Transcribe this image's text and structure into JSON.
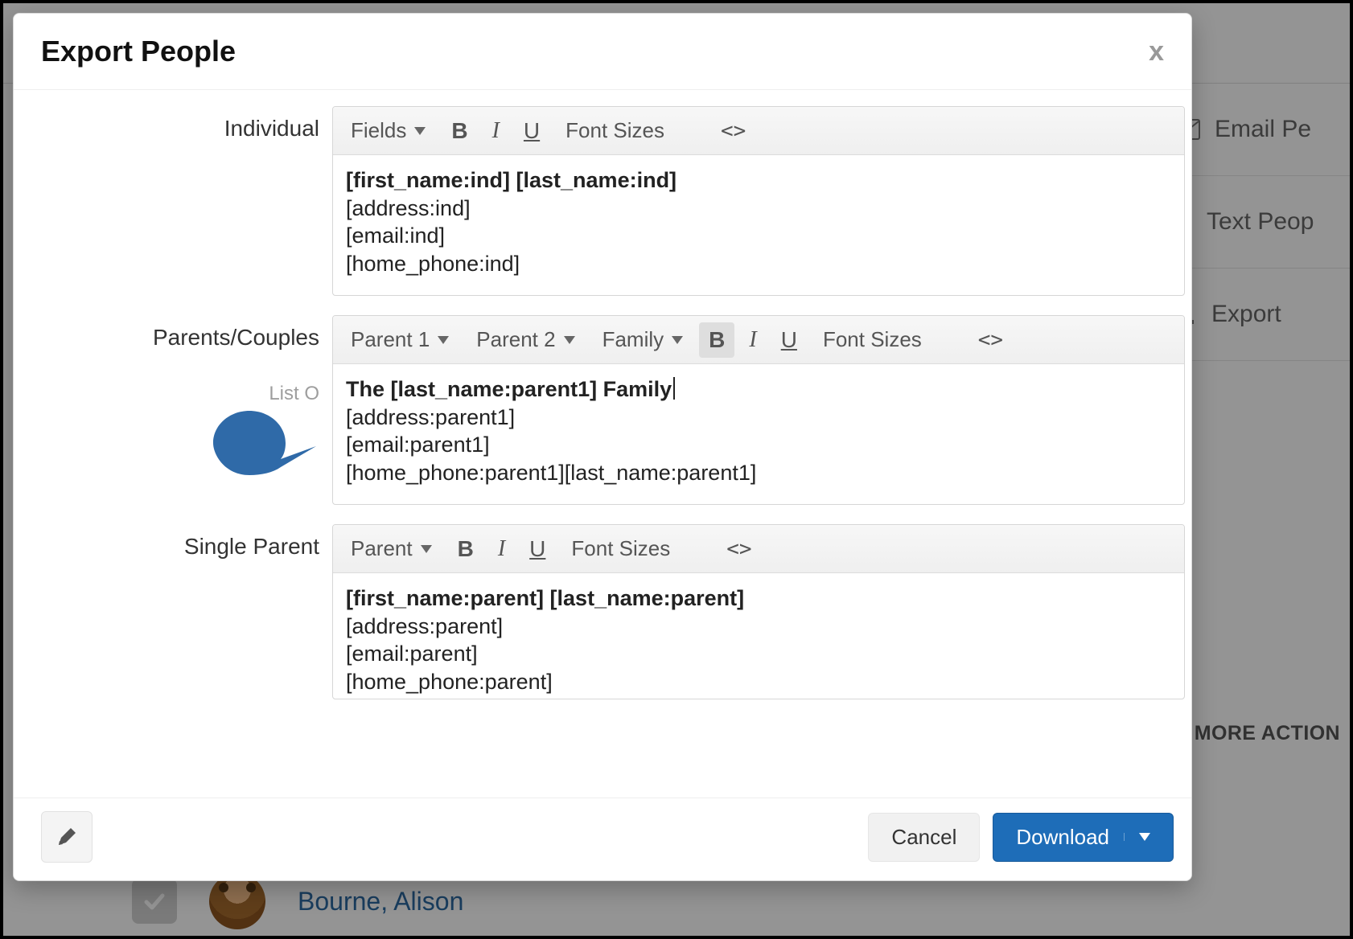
{
  "modal": {
    "title": "Export People",
    "close_label": "x",
    "rows": {
      "individual": {
        "label": "Individual",
        "toolbar": {
          "fields_label": "Fields",
          "font_sizes_label": "Font Sizes"
        },
        "content": {
          "line1_bold": "[first_name:ind] [last_name:ind]",
          "line2": "[address:ind]",
          "line3": "[email:ind]",
          "line4": "[home_phone:ind]"
        }
      },
      "parents": {
        "label": "Parents/Couples",
        "sublabel": "List O",
        "toolbar": {
          "parent1_label": "Parent 1",
          "parent2_label": "Parent 2",
          "family_label": "Family",
          "font_sizes_label": "Font Sizes",
          "bold_active": true
        },
        "content": {
          "line1_bold": "The [last_name:parent1] Family",
          "line2": "[address:parent1]",
          "line3": "[email:parent1]",
          "line4": "[home_phone:parent1][last_name:parent1]"
        }
      },
      "single": {
        "label": "Single Parent",
        "toolbar": {
          "parent_label": "Parent",
          "font_sizes_label": "Font Sizes"
        },
        "content": {
          "line1_bold": "[first_name:parent] [last_name:parent]",
          "line2": "[address:parent]",
          "line3": "[email:parent]",
          "line4": "[home_phone:parent]"
        }
      }
    },
    "footer": {
      "cancel_label": "Cancel",
      "download_label": "Download"
    }
  },
  "background": {
    "right_items": {
      "email": "Email Pe",
      "text": "Text Peop",
      "export": "Export"
    },
    "more_actions": "MORE ACTION",
    "person_name": "Bourne, Alison"
  },
  "icons": {
    "bold": "B",
    "italic": "I",
    "underline": "U",
    "code": "<>"
  }
}
